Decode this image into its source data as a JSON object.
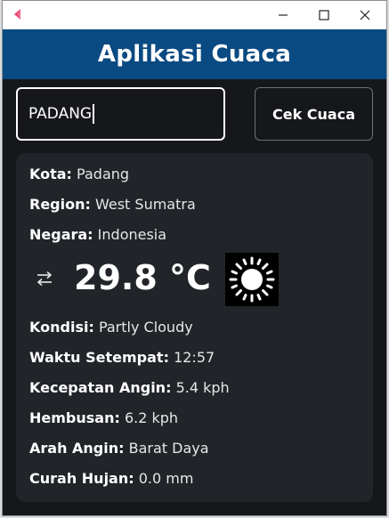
{
  "header": {
    "title": "Aplikasi Cuaca"
  },
  "search": {
    "value": "PADANG",
    "button_label": "Cek Cuaca"
  },
  "weather": {
    "city_label": "Kota:",
    "city": "Padang",
    "region_label": "Region:",
    "region": "West Sumatra",
    "country_label": "Negara:",
    "country": "Indonesia",
    "temperature": "29.8 °C",
    "condition_icon": "sun-icon",
    "condition_label": "Kondisi:",
    "condition": "Partly Cloudy",
    "local_time_label": "Waktu Setempat:",
    "local_time": "12:57",
    "wind_speed_label": "Kecepatan Angin:",
    "wind_speed": "5.4 kph",
    "gust_label": "Hembusan:",
    "gust": "6.2 kph",
    "wind_dir_label": "Arah Angin:",
    "wind_dir": "Barat Daya",
    "precip_label": "Curah Hujan:",
    "precip": "0.0 mm"
  },
  "colors": {
    "header_bg": "#0a4a82",
    "window_bg": "#15171a",
    "card_bg": "#212428"
  }
}
